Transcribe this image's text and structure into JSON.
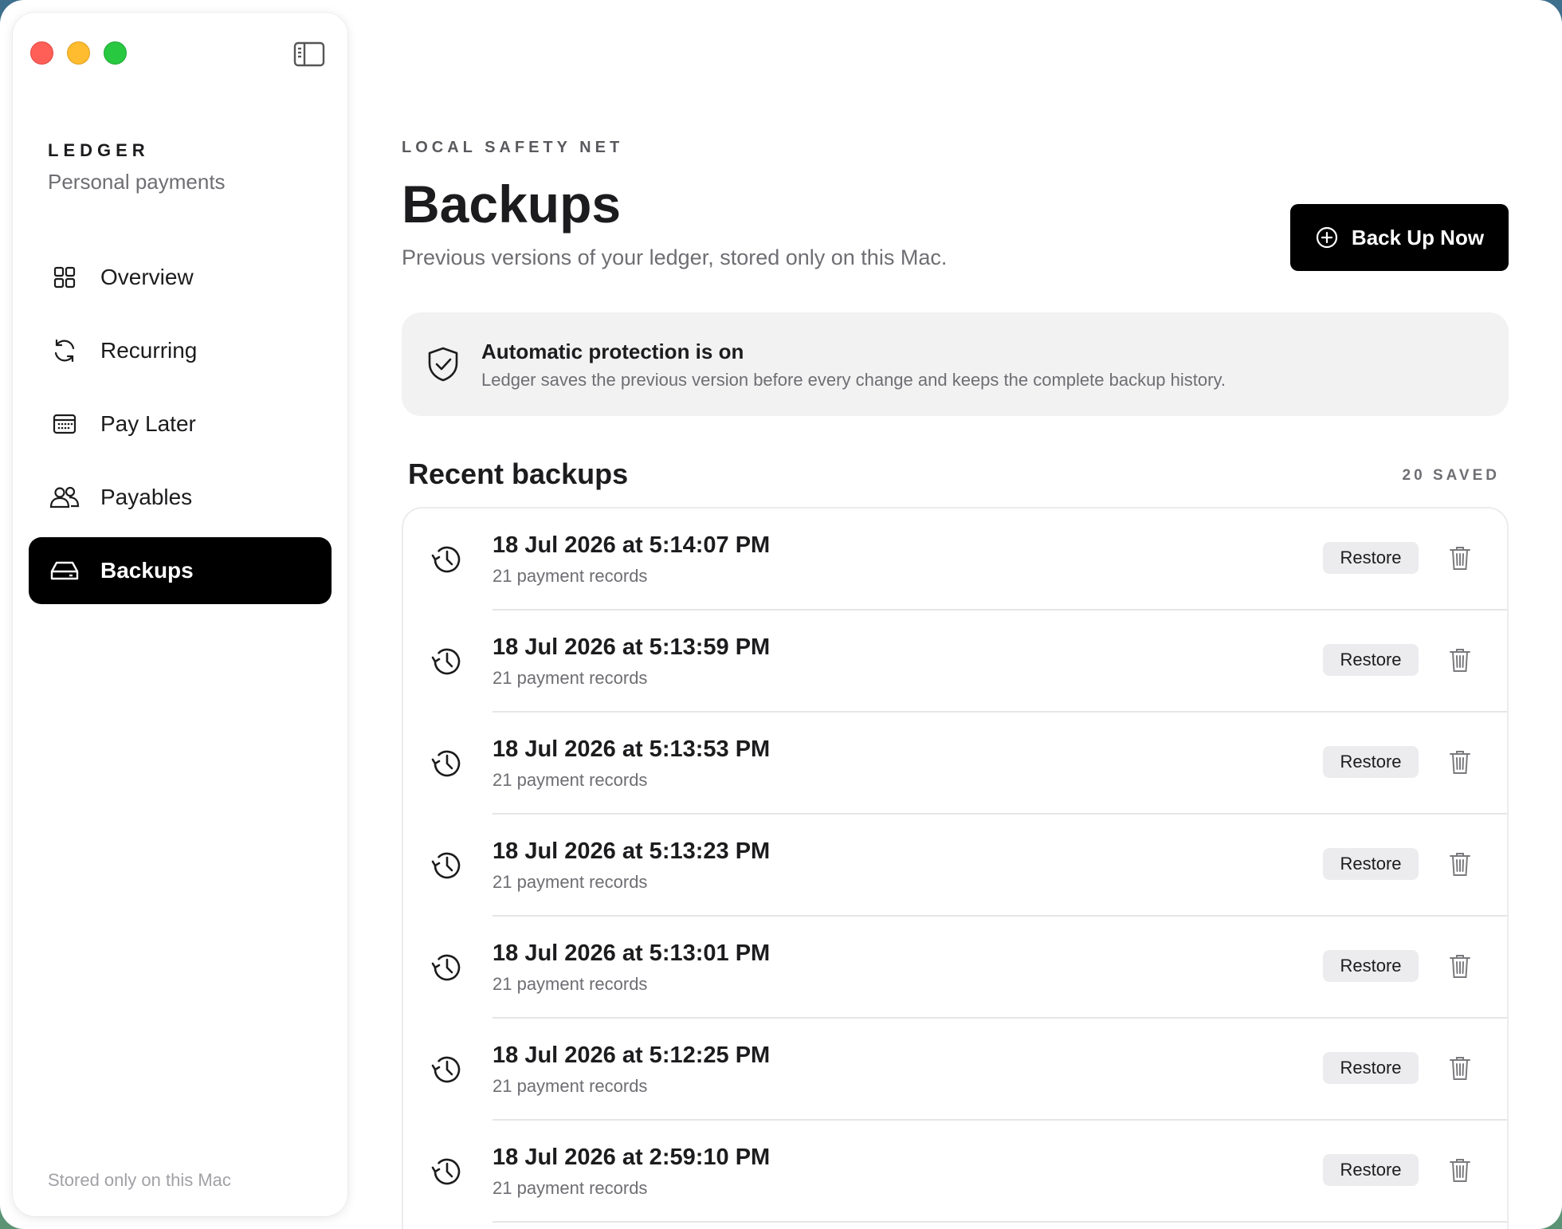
{
  "sidebar": {
    "brand": "LEDGER",
    "brand_subtitle": "Personal payments",
    "items": [
      {
        "label": "Overview",
        "icon": "grid-icon"
      },
      {
        "label": "Recurring",
        "icon": "refresh-icon"
      },
      {
        "label": "Pay Later",
        "icon": "calendar-icon"
      },
      {
        "label": "Payables",
        "icon": "people-icon"
      },
      {
        "label": "Backups",
        "icon": "drive-icon",
        "active": true
      }
    ],
    "footer": "Stored only on this Mac"
  },
  "header": {
    "eyebrow": "LOCAL SAFETY NET",
    "title": "Backups",
    "subtitle": "Previous versions of your ledger, stored only on this Mac.",
    "primary_button": "Back Up Now"
  },
  "notice": {
    "title": "Automatic protection is on",
    "text": "Ledger saves the previous version before every change and keeps the complete backup history."
  },
  "backups": {
    "section_title": "Recent backups",
    "count_label": "20 SAVED",
    "restore_label": "Restore",
    "rows": [
      {
        "time": "18 Jul 2026 at 5:14:07 PM",
        "meta": "21 payment records"
      },
      {
        "time": "18 Jul 2026 at 5:13:59 PM",
        "meta": "21 payment records"
      },
      {
        "time": "18 Jul 2026 at 5:13:53 PM",
        "meta": "21 payment records"
      },
      {
        "time": "18 Jul 2026 at 5:13:23 PM",
        "meta": "21 payment records"
      },
      {
        "time": "18 Jul 2026 at 5:13:01 PM",
        "meta": "21 payment records"
      },
      {
        "time": "18 Jul 2026 at 5:12:25 PM",
        "meta": "21 payment records"
      },
      {
        "time": "18 Jul 2026 at 2:59:10 PM",
        "meta": "21 payment records"
      }
    ]
  },
  "colors": {
    "accent": "#000000",
    "traffic_red": "#ff5f57",
    "traffic_yellow": "#febc2e",
    "traffic_green": "#28c840"
  }
}
